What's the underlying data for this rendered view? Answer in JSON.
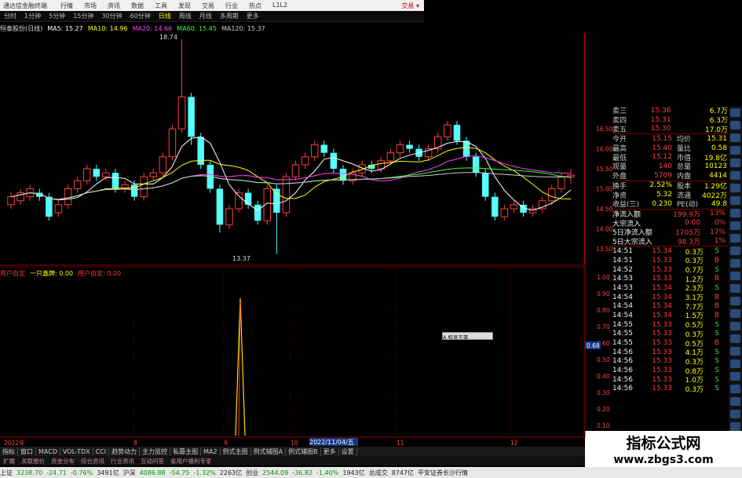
{
  "window": {
    "title": "通达信金融终端",
    "trade_label": "交易 ▾"
  },
  "menu": [
    "行情",
    "市场",
    "资讯",
    "数据",
    "工具",
    "发现",
    "交易",
    "行业",
    "热点",
    "L1L2"
  ],
  "periods": [
    "分时",
    "1分钟",
    "5分钟",
    "15分钟",
    "30分钟",
    "60分钟",
    "日线",
    "周线",
    "月线",
    "多周期",
    "更多"
  ],
  "active_period": "日线",
  "ma_legend": [
    {
      "text": "恒泰股份(日线)",
      "color": "#ddd"
    },
    {
      "text": "MA5: 15.27",
      "color": "#ffffff"
    },
    {
      "text": "MA10: 14.96",
      "color": "#ffff00"
    },
    {
      "text": "MA20: 14.66",
      "color": "#ff44ff"
    },
    {
      "text": "MA60: 15.45",
      "color": "#33ff33"
    },
    {
      "text": "MA120: 15.37",
      "color": "#cccccc"
    }
  ],
  "sub_legend": [
    {
      "text": "用户自定",
      "color": "#ff3333"
    },
    {
      "text": "一只鑫牌: 0.00",
      "color": "#ffff00"
    },
    {
      "text": "用户自定: 0.00",
      "color": "#ff3333"
    }
  ],
  "annotations": {
    "high": "18.74",
    "low": "13.37"
  },
  "price_axis": [
    "16.50",
    "16.00",
    "15.50",
    "15.00",
    "14.50",
    "14.00",
    "13.50"
  ],
  "sub_axis": [
    "1.00",
    "0.90",
    "0.80",
    "0.70",
    "0.60",
    "0.50",
    "0.40",
    "0.30",
    "0.20",
    "0.10"
  ],
  "sub_current": "0.68",
  "chart_data": {
    "type": "candlestick",
    "ylim": [
      13.3,
      18.9
    ],
    "candles": [
      [
        14.6,
        14.8,
        14.5,
        14.9
      ],
      [
        14.7,
        14.9,
        14.6,
        15.0
      ],
      [
        14.8,
        15.0,
        14.7,
        15.1
      ],
      [
        14.9,
        14.8,
        14.7,
        15.0
      ],
      [
        14.8,
        14.3,
        14.2,
        14.9
      ],
      [
        14.4,
        14.6,
        14.3,
        14.7
      ],
      [
        14.6,
        15.0,
        14.5,
        15.1
      ],
      [
        15.0,
        15.2,
        14.9,
        15.3
      ],
      [
        15.2,
        15.5,
        15.1,
        15.6
      ],
      [
        15.5,
        15.3,
        15.2,
        15.6
      ],
      [
        15.3,
        15.4,
        15.2,
        15.5
      ],
      [
        15.4,
        15.0,
        14.9,
        15.5
      ],
      [
        15.0,
        15.1,
        14.9,
        15.2
      ],
      [
        15.1,
        14.8,
        14.7,
        15.2
      ],
      [
        14.8,
        15.3,
        14.7,
        15.4
      ],
      [
        15.3,
        15.4,
        15.2,
        15.5
      ],
      [
        15.4,
        15.8,
        15.3,
        15.9
      ],
      [
        15.8,
        16.5,
        15.7,
        16.6
      ],
      [
        16.5,
        17.3,
        16.4,
        18.74
      ],
      [
        17.3,
        16.3,
        16.1,
        17.4
      ],
      [
        16.3,
        15.6,
        15.5,
        16.4
      ],
      [
        15.6,
        15.0,
        14.9,
        15.7
      ],
      [
        15.0,
        14.1,
        13.9,
        15.1
      ],
      [
        14.1,
        14.5,
        14.0,
        14.6
      ],
      [
        14.5,
        14.9,
        14.4,
        15.0
      ],
      [
        14.9,
        14.6,
        14.5,
        15.0
      ],
      [
        14.6,
        14.2,
        14.1,
        14.7
      ],
      [
        14.2,
        15.0,
        14.1,
        15.1
      ],
      [
        15.0,
        14.4,
        13.37,
        15.1
      ],
      [
        14.4,
        15.3,
        14.3,
        15.4
      ],
      [
        15.3,
        15.6,
        15.2,
        15.7
      ],
      [
        15.6,
        15.8,
        15.5,
        15.9
      ],
      [
        15.8,
        16.1,
        15.7,
        16.2
      ],
      [
        16.1,
        15.9,
        15.8,
        16.2
      ],
      [
        15.9,
        15.5,
        15.4,
        16.0
      ],
      [
        15.5,
        15.2,
        15.1,
        15.6
      ],
      [
        15.2,
        15.4,
        15.1,
        15.5
      ],
      [
        15.4,
        15.6,
        15.3,
        15.7
      ],
      [
        15.6,
        15.5,
        15.4,
        15.7
      ],
      [
        15.5,
        15.7,
        15.4,
        15.8
      ],
      [
        15.7,
        15.9,
        15.6,
        16.0
      ],
      [
        15.9,
        16.1,
        15.8,
        16.2
      ],
      [
        16.1,
        16.0,
        15.9,
        16.2
      ],
      [
        16.0,
        15.8,
        15.7,
        16.1
      ],
      [
        15.8,
        16.0,
        15.7,
        16.1
      ],
      [
        16.0,
        16.3,
        15.9,
        16.4
      ],
      [
        16.3,
        16.6,
        16.2,
        16.7
      ],
      [
        16.6,
        16.2,
        16.1,
        16.7
      ],
      [
        16.2,
        15.8,
        15.7,
        16.3
      ],
      [
        15.8,
        15.4,
        15.3,
        15.9
      ],
      [
        15.4,
        14.8,
        14.7,
        15.5
      ],
      [
        14.8,
        14.3,
        14.2,
        14.9
      ],
      [
        14.3,
        14.5,
        14.2,
        14.6
      ],
      [
        14.5,
        14.6,
        14.4,
        14.7
      ],
      [
        14.6,
        14.4,
        14.3,
        14.7
      ],
      [
        14.4,
        14.5,
        14.3,
        14.6
      ],
      [
        14.5,
        14.7,
        14.4,
        14.8
      ],
      [
        14.7,
        15.0,
        14.6,
        15.1
      ],
      [
        15.0,
        15.3,
        14.9,
        15.4
      ],
      [
        15.3,
        15.34,
        15.12,
        15.5
      ]
    ]
  },
  "quotes": {
    "levels": [
      {
        "label": "卖三",
        "price": "15.36",
        "vol": "6.7万"
      },
      {
        "label": "卖四",
        "price": "15.31",
        "vol": "6.3万"
      },
      {
        "label": "卖五",
        "price": "15.30",
        "vol": "17.0万"
      }
    ],
    "stats": [
      {
        "l1": "今开",
        "v1": "15.15",
        "l2": "均价",
        "v2": "15.31"
      },
      {
        "l1": "最高",
        "v1": "15.40",
        "l2": "量比",
        "v2": "0.58"
      },
      {
        "l1": "最低",
        "v1": "15.12",
        "l2": "市值",
        "v2": "19.8亿"
      },
      {
        "l1": "现量",
        "v1": "140",
        "l2": "总量",
        "v2": "10123"
      },
      {
        "l1": "外盘",
        "v1": "5709",
        "l2": "内盘",
        "v2": "4414"
      }
    ],
    "stats2": [
      {
        "l1": "换手",
        "v1": "2.52%",
        "l2": "股本",
        "v2": "1.29亿"
      },
      {
        "l1": "净资",
        "v1": "5.32",
        "l2": "流通",
        "v2": "4022万"
      },
      {
        "l1": "收益(三)",
        "v1": "0.230",
        "l2": "PE(动)",
        "v2": "49.8"
      }
    ],
    "flows": [
      {
        "label": "净流入额",
        "value": "199.9万",
        "pct": "13%"
      },
      {
        "label": "大宗流入",
        "value": "0.00",
        "pct": "0%"
      },
      {
        "label": "5日净流入额",
        "value": "1705万",
        "pct": "17%"
      },
      {
        "label": "5日大宗流入",
        "value": "98.3万",
        "pct": "1%"
      }
    ],
    "ticks": [
      {
        "t": "14:51",
        "p": "15.34",
        "v": "0.3万",
        "s": "S"
      },
      {
        "t": "14:51",
        "p": "15.33",
        "v": "0.3万",
        "s": "B"
      },
      {
        "t": "14:52",
        "p": "15.33",
        "v": "0.7万",
        "s": "S"
      },
      {
        "t": "14:53",
        "p": "15.33",
        "v": "1.2万",
        "s": "B"
      },
      {
        "t": "14:53",
        "p": "15.34",
        "v": "2.3万",
        "s": "S"
      },
      {
        "t": "14:54",
        "p": "15.34",
        "v": "3.1万",
        "s": "B"
      },
      {
        "t": "14:54",
        "p": "15.34",
        "v": "7.7万",
        "s": "B"
      },
      {
        "t": "14:54",
        "p": "15.34",
        "v": "1.5万",
        "s": "B"
      },
      {
        "t": "14:55",
        "p": "15.33",
        "v": "0.5万",
        "s": "S"
      },
      {
        "t": "14:55",
        "p": "15.33",
        "v": "0.3万",
        "s": "S"
      },
      {
        "t": "14:55",
        "p": "15.33",
        "v": "0.5万",
        "s": "B"
      },
      {
        "t": "14:56",
        "p": "15.33",
        "v": "4.1万",
        "s": "S"
      },
      {
        "t": "14:56",
        "p": "15.33",
        "v": "0.3万",
        "s": "S"
      },
      {
        "t": "14:56",
        "p": "15.33",
        "v": "0.8万",
        "s": "S"
      },
      {
        "t": "14:56",
        "p": "15.33",
        "v": "1.0万",
        "s": "S"
      },
      {
        "t": "14:56",
        "p": "15.33",
        "v": "0.3万",
        "s": "S"
      }
    ]
  },
  "date_marker": "2022/11/04/五",
  "axis_dates": [
    "2022年",
    "8",
    "9",
    "10",
    "11",
    "12"
  ],
  "popup": "A 权息五笔",
  "tabs": [
    "指标",
    "窗口",
    "MACD",
    "VOL-TDX",
    "CCI",
    "趋势动力",
    "主力监控",
    "私募主图",
    "MA2",
    "例式主图",
    "例式辅图A",
    "例式辅图B",
    "更多",
    "设置"
  ],
  "tabs2": [
    "扩展",
    "关联报价",
    "资金分布",
    "综合资讯",
    "行业资讯",
    "互动问答",
    "省用户福利专享"
  ],
  "status": [
    {
      "text": "上证",
      "cls": ""
    },
    {
      "text": "3238.70",
      "cls": "g"
    },
    {
      "text": "-24.71",
      "cls": "g"
    },
    {
      "text": "-0.76%",
      "cls": "g"
    },
    {
      "text": "3491亿",
      "cls": ""
    },
    {
      "text": "沪深",
      "cls": ""
    },
    {
      "text": "4086.88",
      "cls": "g"
    },
    {
      "text": "-54.75",
      "cls": "g"
    },
    {
      "text": "-1.32%",
      "cls": "g"
    },
    {
      "text": "2263亿",
      "cls": ""
    },
    {
      "text": "创业",
      "cls": ""
    },
    {
      "text": "2544.09",
      "cls": "g"
    },
    {
      "text": "-36.82",
      "cls": "g"
    },
    {
      "text": "-1.40%",
      "cls": "g"
    },
    {
      "text": "1943亿",
      "cls": ""
    },
    {
      "text": "总成交",
      "cls": ""
    },
    {
      "text": "8747亿",
      "cls": ""
    },
    {
      "text": "平安证券长沙行情",
      "cls": ""
    }
  ],
  "watermark": {
    "title": "指标公式网",
    "url": "www.zbgs3.com"
  }
}
